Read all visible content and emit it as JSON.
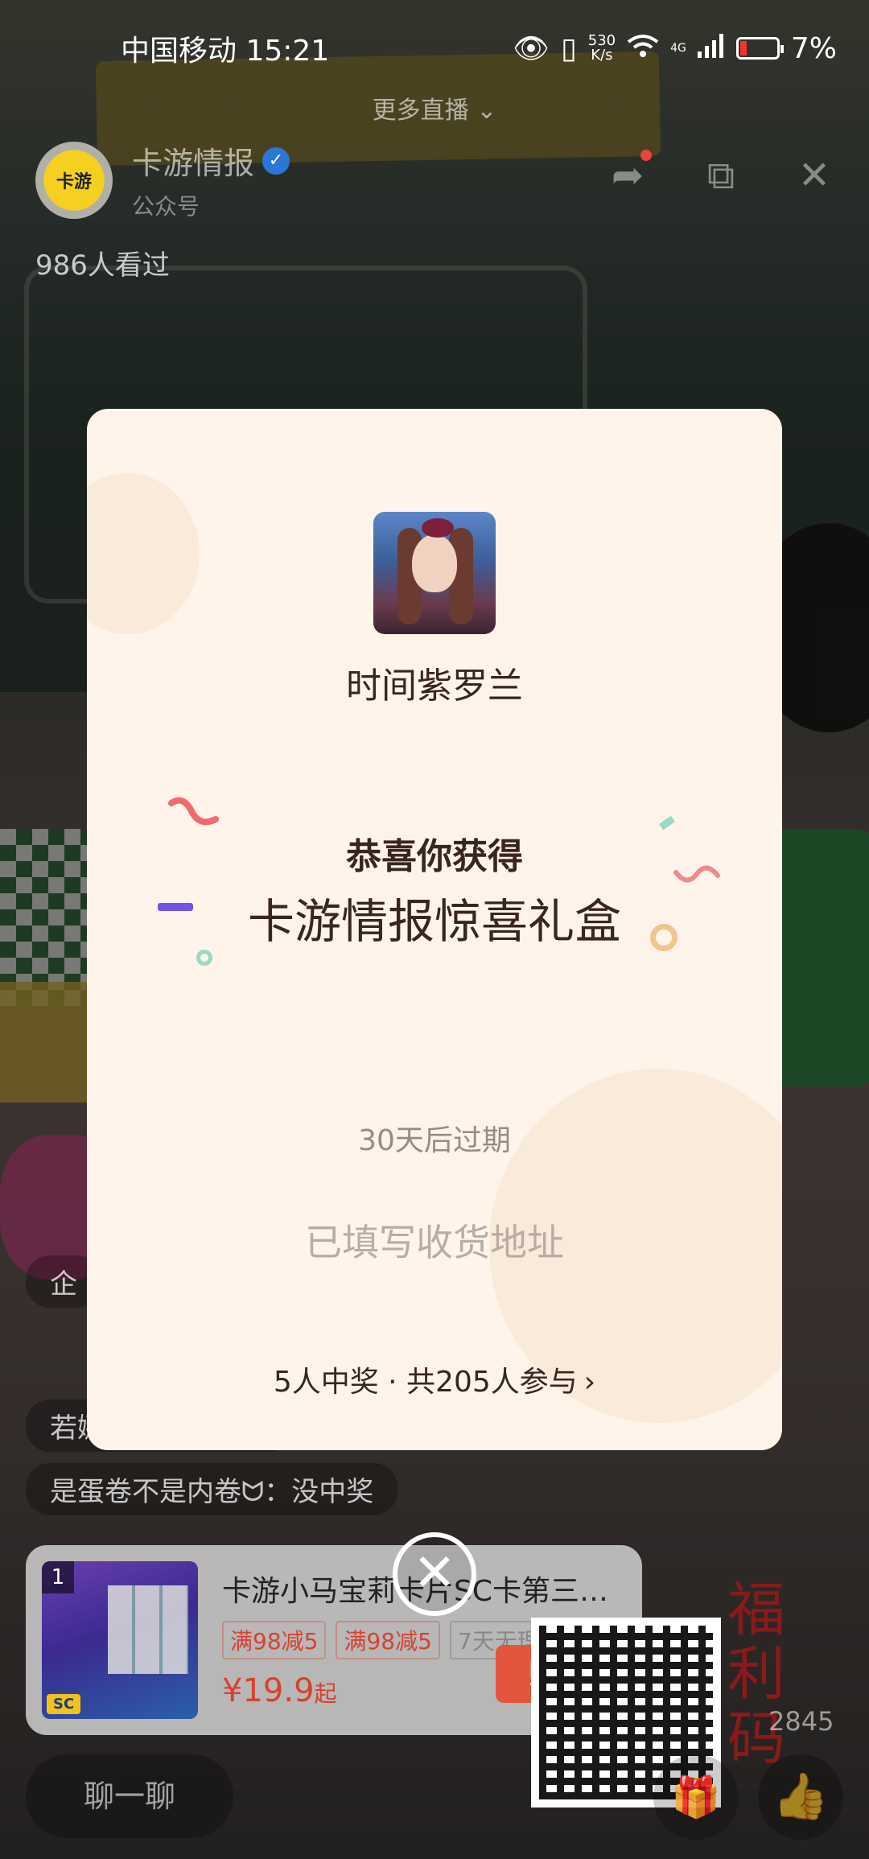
{
  "status_bar": {
    "carrier_time": "中国移动 15:21",
    "net_speed_value": "530",
    "net_speed_unit": "K/s",
    "signal_label": "4G",
    "battery": "7%"
  },
  "header": {
    "more_live": "更多直播",
    "account_name": "卡游情报",
    "account_type": "公众号",
    "avatar_text": "卡游",
    "viewers": "986人看过"
  },
  "comments": [
    "企",
    "若娜：我在油头市",
    "是蛋卷不是内卷ᗢ：没中奖"
  ],
  "modal": {
    "prize_name": "时间紫罗兰",
    "congrats": "恭喜你获得",
    "prize_title": "卡游情报惊喜礼盒",
    "expiry": "30天后过期",
    "address_status": "已填写收货地址",
    "winners": "5人中奖 · 共205人参与"
  },
  "product": {
    "rank": "1",
    "badge": "SC",
    "title": "卡游小马宝莉卡片SC卡第三…",
    "tags": [
      "满98减5",
      "满98减5",
      "7天无理由"
    ],
    "price": "¥19.9",
    "price_suffix": "起",
    "buy_label": "购买"
  },
  "side": {
    "welfare_code": "福利码",
    "like_count": "2845"
  },
  "bottom": {
    "chat_label": "聊一聊"
  },
  "colors": {
    "modal_bg": "#fef4ea",
    "accent_red": "#d6422e",
    "buy_button": "#e4553e"
  }
}
